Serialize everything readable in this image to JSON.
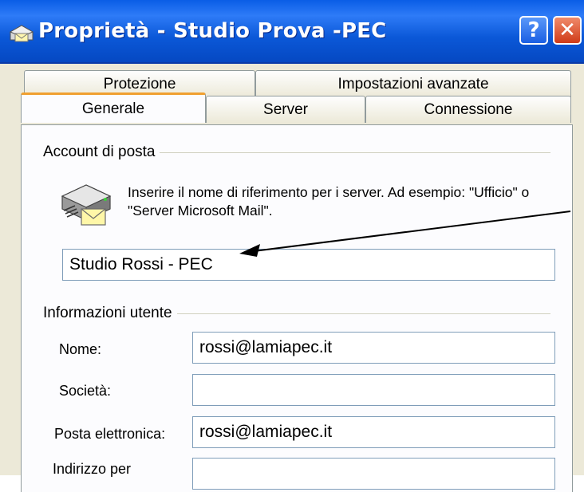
{
  "window": {
    "title": "Proprietà - Studio Prova -PEC",
    "icon": "mail-account-icon",
    "help_label": "?",
    "close_label": "✕"
  },
  "tabs": {
    "row1": [
      "Protezione",
      "Impostazioni avanzate"
    ],
    "row2": [
      "Generale",
      "Server",
      "Connessione"
    ],
    "active": "Generale"
  },
  "account": {
    "group_label": "Account di posta",
    "description": "Inserire il nome di riferimento per i server. Ad esempio: \"Ufficio\" o \"Server Microsoft Mail\".",
    "name_value": "Studio Rossi - PEC"
  },
  "user_info": {
    "group_label": "Informazioni utente",
    "fields": [
      {
        "label": "Nome:",
        "value": "rossi@lamiapec.it"
      },
      {
        "label": "Società:",
        "value": ""
      },
      {
        "label": "Posta elettronica:",
        "value": "rossi@lamiapec.it"
      },
      {
        "label": "Indirizzo per",
        "value": ""
      }
    ]
  },
  "colors": {
    "titlebar": "#0b58d8",
    "dialog_bg": "#ece9d8",
    "active_tab_accent": "#f0a030",
    "input_border": "#7f9db9"
  }
}
